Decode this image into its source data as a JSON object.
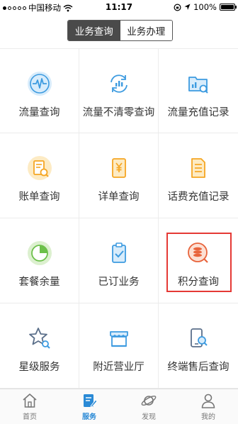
{
  "status_bar": {
    "carrier": "中国移动",
    "time": "11:17",
    "battery": "100%",
    "battery_level": 1.0
  },
  "segment": {
    "tabs": [
      "业务查询",
      "业务办理"
    ],
    "selected": "业务查询"
  },
  "grid": {
    "items": [
      {
        "label": "流量查询",
        "icon": "waveform-icon"
      },
      {
        "label": "流量不清零查询",
        "icon": "refresh-chart-icon"
      },
      {
        "label": "流量充值记录",
        "icon": "folder-search-icon"
      },
      {
        "label": "账单查询",
        "icon": "bill-icon"
      },
      {
        "label": "详单查询",
        "icon": "yuan-document-icon"
      },
      {
        "label": "话费充值记录",
        "icon": "document-list-icon"
      },
      {
        "label": "套餐余量",
        "icon": "pie-chart-icon"
      },
      {
        "label": "已订业务",
        "icon": "clipboard-check-icon"
      },
      {
        "label": "积分查询",
        "icon": "coins-search-icon"
      },
      {
        "label": "星级服务",
        "icon": "star-search-icon"
      },
      {
        "label": "附近营业厅",
        "icon": "storefront-icon"
      },
      {
        "label": "终端售后查询",
        "icon": "phone-search-icon"
      }
    ]
  },
  "tabbar": {
    "tabs": [
      {
        "label": "首页",
        "icon": "home-icon"
      },
      {
        "label": "服务",
        "icon": "service-icon"
      },
      {
        "label": "发现",
        "icon": "planet-icon"
      },
      {
        "label": "我的",
        "icon": "user-icon"
      }
    ],
    "active": "服务"
  },
  "colors": {
    "accent_blue": "#2a8ad6",
    "icon_orange": "#f5a623",
    "icon_green": "#6cc04a",
    "icon_red": "#e8643c",
    "highlight_red": "#e53935"
  }
}
